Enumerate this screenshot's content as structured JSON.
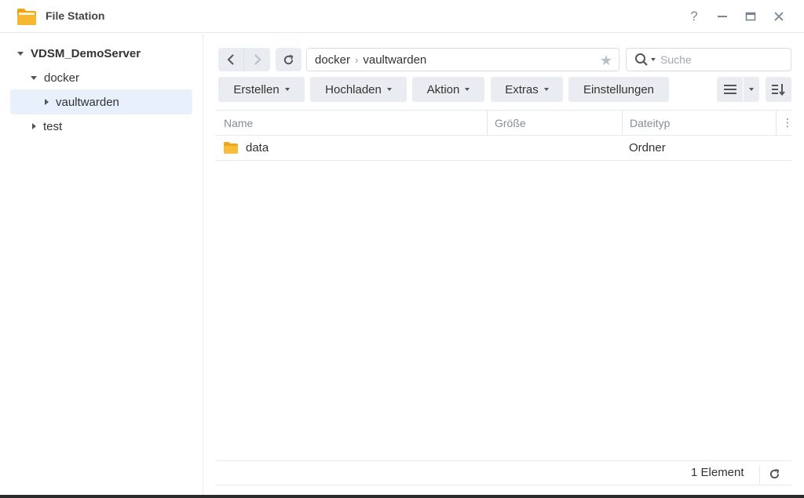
{
  "window": {
    "title": "File Station"
  },
  "controls": {
    "help": "?"
  },
  "sidebar": {
    "root": "VDSM_DemoServer",
    "items": [
      {
        "label": "docker"
      },
      {
        "label": "vaultwarden"
      },
      {
        "label": "test"
      }
    ]
  },
  "address": {
    "segments": [
      "docker",
      "vaultwarden"
    ]
  },
  "search": {
    "placeholder": "Suche"
  },
  "toolbar": {
    "create": "Erstellen",
    "upload": "Hochladen",
    "action": "Aktion",
    "tools": "Extras",
    "settings": "Einstellungen"
  },
  "table": {
    "columns": [
      "Name",
      "Größe",
      "Dateityp"
    ],
    "rows": [
      {
        "name": "data",
        "size": "",
        "type": "Ordner"
      }
    ]
  },
  "status": {
    "count": "1 Element"
  },
  "colors": {
    "folder": "#f5b630",
    "selected": "#e7f0fb",
    "button": "#e9edf2"
  }
}
